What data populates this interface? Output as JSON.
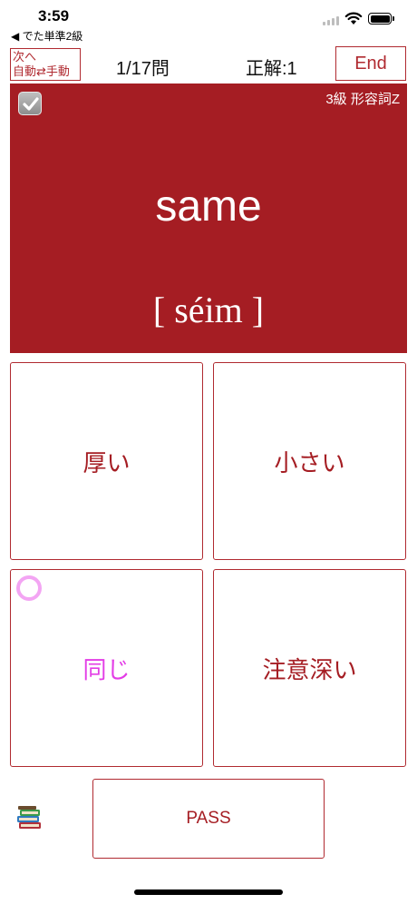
{
  "status_bar": {
    "time": "3:59",
    "back_label": "◀ でた単準2級"
  },
  "header": {
    "next_line1": "次へ",
    "next_line2": "自動⇄手動",
    "counter": "1/17問",
    "correct": "正解:1",
    "end_label": "End"
  },
  "card": {
    "level": "3級  形容詞Z",
    "word": "same",
    "pronunciation": "[ séim ]",
    "color": "#a51d23"
  },
  "answers": [
    {
      "label": "厚い",
      "selected": false
    },
    {
      "label": "小さい",
      "selected": false
    },
    {
      "label": "同じ",
      "selected": true
    },
    {
      "label": "注意深い",
      "selected": false
    }
  ],
  "bottom": {
    "pass_label": "PASS",
    "books_icon": "books-icon"
  },
  "colors": {
    "accent": "#a51d23",
    "selected": "#e33de6"
  }
}
